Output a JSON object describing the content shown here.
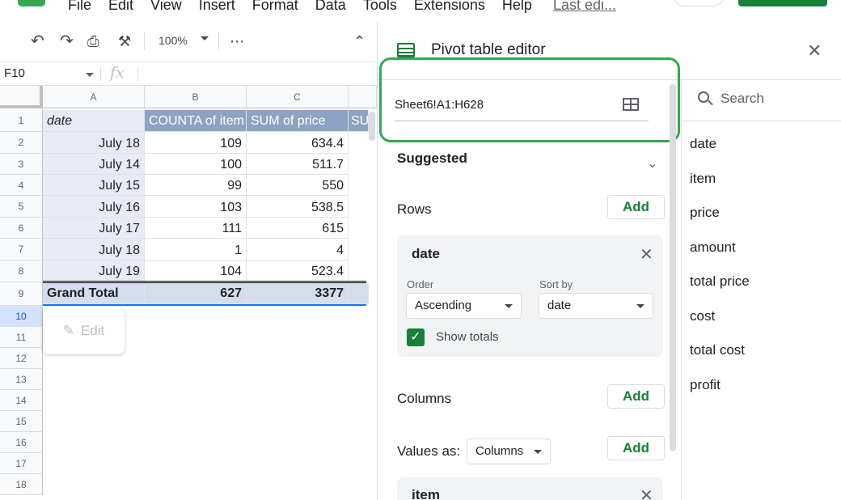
{
  "menubar": {
    "items": [
      "File",
      "Edit",
      "View",
      "Insert",
      "Format",
      "Data",
      "Tools",
      "Extensions",
      "Help"
    ],
    "last_edit": "Last edi..."
  },
  "toolbar": {
    "zoom": "100%"
  },
  "formula_bar": {
    "name_box": "F10",
    "fx": "fx"
  },
  "grid": {
    "columns": [
      "A",
      "B",
      "C"
    ],
    "rows": [
      "1",
      "2",
      "3",
      "4",
      "5",
      "6",
      "7",
      "8",
      "9",
      "10",
      "11",
      "12",
      "13",
      "14",
      "15",
      "16",
      "17",
      "18"
    ],
    "header": [
      "date",
      "COUNTA of item",
      "SUM of price",
      "SU"
    ],
    "data": [
      [
        "July 18",
        "109",
        "634.4"
      ],
      [
        "July 14",
        "100",
        "511.7"
      ],
      [
        "July 15",
        "99",
        "550"
      ],
      [
        "July 16",
        "103",
        "538.5"
      ],
      [
        "July 17",
        "111",
        "615"
      ],
      [
        "July 18",
        "1",
        "4"
      ],
      [
        "July 19",
        "104",
        "523.4"
      ]
    ],
    "grand_total": [
      "Grand Total",
      "627",
      "3377"
    ],
    "edit_label": "Edit"
  },
  "pivot": {
    "title": "Pivot table editor",
    "range": "Sheet6!A1:H628",
    "suggested": "Suggested",
    "rows_label": "Rows",
    "columns_label": "Columns",
    "values_as_label": "Values as:",
    "values_as_value": "Columns",
    "add_label": "Add",
    "rows_card": {
      "title": "date",
      "order_label": "Order",
      "order_value": "Ascending",
      "sort_label": "Sort by",
      "sort_value": "date",
      "show_totals": "Show totals"
    },
    "values_card": {
      "title": "item"
    },
    "search_placeholder": "Search",
    "fields": [
      "date",
      "item",
      "price",
      "amount",
      "total price",
      "cost",
      "total cost",
      "profit"
    ]
  }
}
